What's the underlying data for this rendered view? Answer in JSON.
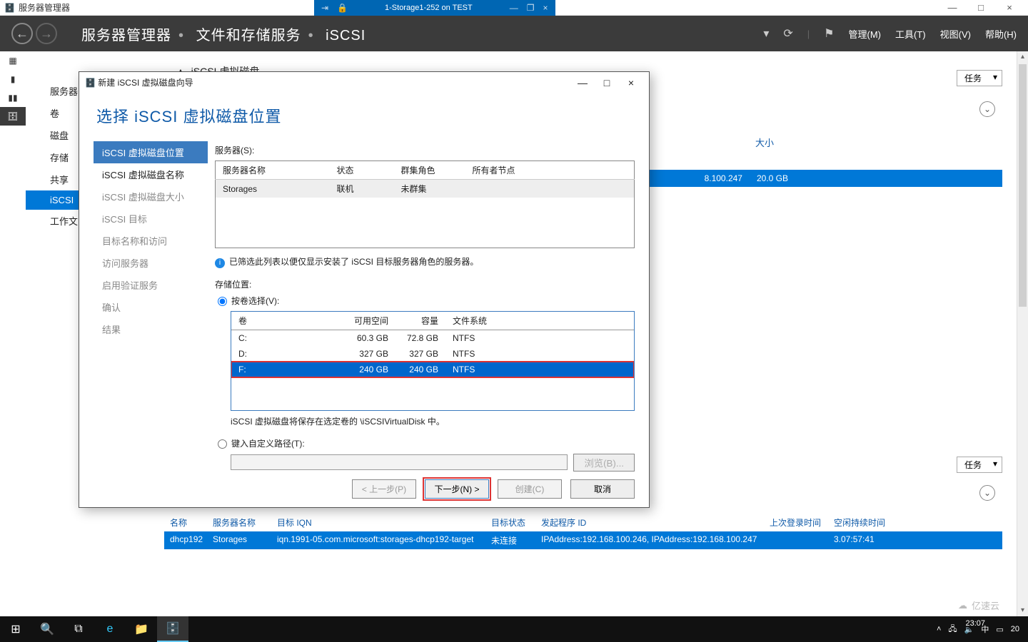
{
  "outer": {
    "title": "服务器管理器",
    "min": "—",
    "max": "□",
    "close": "×"
  },
  "remote": {
    "pin": "⇥",
    "lock": "🔒",
    "title": "1-Storage1-252 on TEST",
    "min": "—",
    "restore": "❐",
    "close": "×"
  },
  "smheader": {
    "crumbs": [
      "服务器管理器",
      "文件和存储服务",
      "iSCSI"
    ],
    "menu": {
      "manage": "管理(M)",
      "tools": "工具(T)",
      "view": "视图(V)",
      "help": "帮助(H)"
    }
  },
  "leftnav": [
    "服务器",
    "卷",
    "磁盘",
    "存储",
    "共享",
    "iSCSI",
    "工作文"
  ],
  "leftnav_selected": "iSCSI",
  "bg": {
    "partial_title": "iSCSI 虚拟磁盘",
    "size_hdr": "大小",
    "row_ip": "8.100.247",
    "row_size": "20.0 GB",
    "tasks": "任务"
  },
  "bottom": {
    "headers": {
      "name": "名称",
      "server": "服务器名称",
      "iqn": "目标 IQN",
      "status": "目标状态",
      "initiator": "发起程序 ID",
      "last": "上次登录时间",
      "idle": "空闲持续时间"
    },
    "row": {
      "name": "dhcp192",
      "server": "Storages",
      "iqn": "iqn.1991-05.com.microsoft:storages-dhcp192-target",
      "status": "未连接",
      "initiator": "IPAddress:192.168.100.246, IPAddress:192.168.100.247",
      "last": "",
      "idle": "3.07:57:41"
    }
  },
  "wizard": {
    "title": "新建 iSCSI 虚拟磁盘向导",
    "heading": "选择 iSCSI 虚拟磁盘位置",
    "steps": [
      "iSCSI 虚拟磁盘位置",
      "iSCSI 虚拟磁盘名称",
      "iSCSI 虚拟磁盘大小",
      "iSCSI 目标",
      "目标名称和访问",
      "访问服务器",
      "启用验证服务",
      "确认",
      "结果"
    ],
    "server_label": "服务器(S):",
    "server_cols": {
      "name": "服务器名称",
      "status": "状态",
      "role": "群集角色",
      "owner": "所有者节点"
    },
    "server_row": {
      "name": "Storages",
      "status": "联机",
      "role": "未群集",
      "owner": ""
    },
    "info": "已筛选此列表以便仅显示安装了 iSCSI 目标服务器角色的服务器。",
    "storage_label": "存储位置:",
    "radio_vol": "按卷选择(V):",
    "vol_cols": {
      "vol": "卷",
      "free": "可用空间",
      "cap": "容量",
      "fs": "文件系统"
    },
    "vol_rows": [
      {
        "vol": "C:",
        "free": "60.3 GB",
        "cap": "72.8 GB",
        "fs": "NTFS"
      },
      {
        "vol": "D:",
        "free": "327 GB",
        "cap": "327 GB",
        "fs": "NTFS"
      },
      {
        "vol": "F:",
        "free": "240 GB",
        "cap": "240 GB",
        "fs": "NTFS"
      }
    ],
    "note": "iSCSI 虚拟磁盘将保存在选定卷的 \\iSCSIVirtualDisk 中。",
    "radio_path": "键入自定义路径(T):",
    "browse": "浏览(B)...",
    "btn_prev": "< 上一步(P)",
    "btn_next": "下一步(N) >",
    "btn_create": "创建(C)",
    "btn_cancel": "取消"
  },
  "tray": {
    "time": "23:07",
    "date": "20",
    "ime": "中",
    "net": "🖧",
    "snd": "🔈"
  },
  "watermark": "亿速云"
}
